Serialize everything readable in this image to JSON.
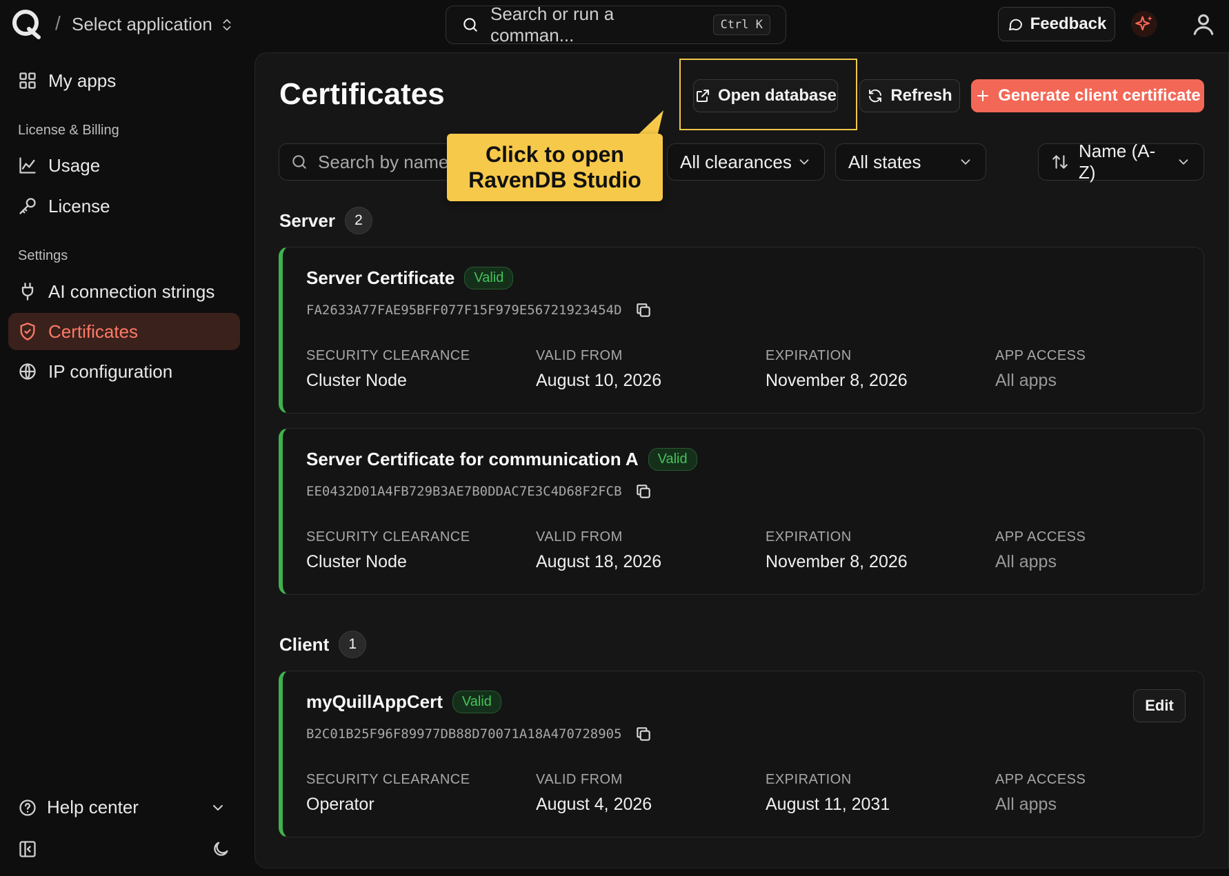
{
  "topbar": {
    "slash": "/",
    "select_application": "Select application",
    "command_placeholder": "Search or run a comman...",
    "shortcut": "Ctrl K",
    "feedback": "Feedback"
  },
  "sidebar": {
    "my_apps": "My apps",
    "license_billing_label": "License & Billing",
    "usage": "Usage",
    "license": "License",
    "settings_label": "Settings",
    "ai_connection_strings": "AI connection strings",
    "certificates": "Certificates",
    "ip_configuration": "IP configuration",
    "help_center": "Help center"
  },
  "page": {
    "title": "Certificates",
    "open_database": "Open database",
    "refresh": "Refresh",
    "generate": "Generate client certificate",
    "search_placeholder": "Search by name",
    "clearance_filter": "All clearances",
    "state_filter": "All states",
    "sort": "Name (A-Z)",
    "callout_line1": "Click to open",
    "callout_line2": "RavenDB Studio"
  },
  "labels": {
    "security_clearance": "SECURITY CLEARANCE",
    "valid_from": "VALID FROM",
    "expiration": "EXPIRATION",
    "app_access": "APP ACCESS",
    "edit": "Edit"
  },
  "groups": {
    "server": {
      "title": "Server",
      "count": "2"
    },
    "client": {
      "title": "Client",
      "count": "1"
    }
  },
  "certificates": [
    {
      "name": "Server Certificate",
      "status": "Valid",
      "thumbprint": "FA2633A77FAE95BFF077F15F979E56721923454D",
      "clearance": "Cluster Node",
      "valid_from": "August 10, 2026",
      "expiration": "November 8, 2026",
      "app_access": "All apps"
    },
    {
      "name": "Server Certificate for communication A",
      "status": "Valid",
      "thumbprint": "EE0432D01A4FB729B3AE7B0DDAC7E3C4D68F2FCB",
      "clearance": "Cluster Node",
      "valid_from": "August 18, 2026",
      "expiration": "November 8, 2026",
      "app_access": "All apps"
    },
    {
      "name": "myQuillAppCert",
      "status": "Valid",
      "thumbprint": "B2C01B25F96F89977DB88D70071A18A470728905",
      "clearance": "Operator",
      "valid_from": "August 4, 2026",
      "expiration": "August 11, 2031",
      "app_access": "All apps"
    }
  ],
  "colors": {
    "accent": "#f26756",
    "active_nav_bg": "#3a211c",
    "valid_green": "#46c35a",
    "callout_yellow": "#f7c94a"
  },
  "icons": [
    "app-logo-icon",
    "chevron-updown-icon",
    "search-icon",
    "message-icon",
    "sparkle-icon",
    "user-icon",
    "grid-icon",
    "chart-icon",
    "key-icon",
    "plug-icon",
    "shield-icon",
    "globe-icon",
    "external-link-icon",
    "refresh-icon",
    "plus-icon",
    "chevron-down-icon",
    "sort-icon",
    "copy-icon",
    "help-icon",
    "sidebar-toggle-icon",
    "moon-icon"
  ]
}
